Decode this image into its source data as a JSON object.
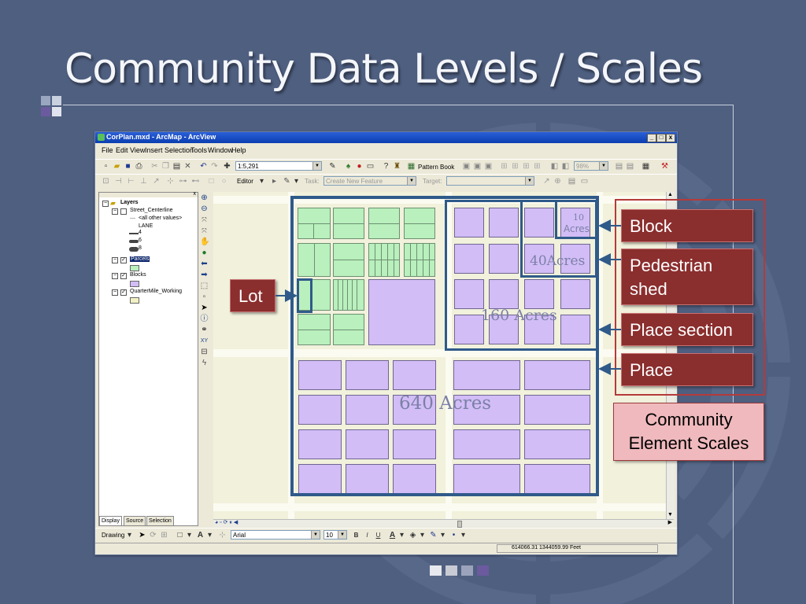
{
  "slide": {
    "title": "Community Data Levels / Scales",
    "colors": {
      "background": "#4f5f80",
      "callout": "#8b2e2e",
      "legend_box": "#efb9bd",
      "parcel": "#b9f0bd",
      "block": "#d2bdf7",
      "selection": "#2f5a8a"
    }
  },
  "window": {
    "title": "CorPlan.mxd - ArcMap - ArcView",
    "controls": {
      "minimize": "_",
      "maximize": "□",
      "close": "x"
    },
    "menu": [
      "File",
      "Edit",
      "View",
      "Insert",
      "Selection",
      "Tools",
      "Window",
      "Help"
    ],
    "toolbar": {
      "scale": "1:5,291",
      "pattern_book": "Pattern Book",
      "zoom_percent": "98%",
      "editor": "Editor",
      "task_label": "Task:",
      "task_value": "Create New Feature",
      "target_label": "Target:"
    },
    "drawing_toolbar": {
      "drawing": "Drawing",
      "font": "Arial",
      "font_size": "10",
      "bold": "B",
      "italic": "I",
      "underline": "U",
      "text_tool": "A"
    },
    "status": {
      "coordinates": "614066.31  1344059.99 Feet"
    }
  },
  "toc": {
    "layers_root": "Layers",
    "items": [
      {
        "label": "Street_Centerline",
        "checked": false
      },
      {
        "label": "<all other values>"
      },
      {
        "label": "LANE"
      },
      {
        "label": "4"
      },
      {
        "label": "6"
      },
      {
        "label": "8"
      },
      {
        "label": "Parcels",
        "checked": true,
        "selected": true
      },
      {
        "label": "Blocks",
        "checked": true
      },
      {
        "label": "QuarterMile_Working",
        "checked": true
      }
    ],
    "tabs": [
      "Display",
      "Source",
      "Selection"
    ]
  },
  "map": {
    "labels": {
      "ten_acres_num": "10",
      "ten_acres_unit": "Acres",
      "forty": "40Acres",
      "one_sixty": "160 Acres",
      "six_forty": "640 Acres"
    }
  },
  "callouts": {
    "lot": "Lot",
    "block": "Block",
    "pedestrian_line1": "Pedestrian",
    "pedestrian_line2": "shed",
    "place_section": "Place section",
    "place": "Place"
  },
  "legend": {
    "line1": "Community",
    "line2": "Element Scales"
  },
  "icons": [
    "search-icon",
    "zoom-in-icon",
    "zoom-out-icon",
    "pan-icon",
    "globe-icon",
    "back-arrow-icon",
    "forward-arrow-icon",
    "pointer-icon",
    "info-icon",
    "binoculars-icon",
    "lightning-icon"
  ]
}
